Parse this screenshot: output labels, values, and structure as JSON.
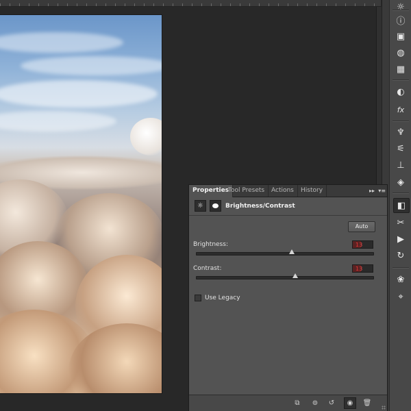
{
  "panel": {
    "tabs": [
      {
        "label": "Properties",
        "active": true
      },
      {
        "label": "Tool Presets",
        "active": false
      },
      {
        "label": "Actions",
        "active": false
      },
      {
        "label": "History",
        "active": false
      }
    ],
    "menu_icons": [
      "double-chevron-right-icon",
      "panel-menu-icon"
    ],
    "header": {
      "title": "Brightness/Contrast",
      "icons": [
        "brightness-contrast-adjustment-icon",
        "layer-mask-icon"
      ]
    },
    "auto_label": "Auto",
    "brightness": {
      "label": "Brightness:",
      "value": "13",
      "slider_fraction": 0.54
    },
    "contrast": {
      "label": "Contrast:",
      "value": "13",
      "slider_fraction": 0.56
    },
    "use_legacy": {
      "label": "Use Legacy",
      "checked": false
    },
    "footer_icons": [
      "clip-to-layer-icon",
      "view-previous-state-icon",
      "reset-icon",
      "visibility-eye-icon",
      "trash-icon"
    ]
  },
  "toolbar": {
    "icons": [
      "adjustments-icon",
      "info-icon",
      "navigator-icon",
      "color-swatches-icon",
      "grid-swatches-icon",
      "styles-icon",
      "fx-icon",
      "brush-presets-icon",
      "brush-icon",
      "clone-source-icon",
      "layers-icon",
      "properties-icon",
      "tools-icon",
      "play-icon",
      "history-icon",
      "channels-icon",
      "paths-icon"
    ],
    "active": "properties-icon",
    "colors": {
      "panel_bg": "#535353",
      "toolbar_bg": "#484848",
      "value_red": "#ff4a4a"
    }
  }
}
